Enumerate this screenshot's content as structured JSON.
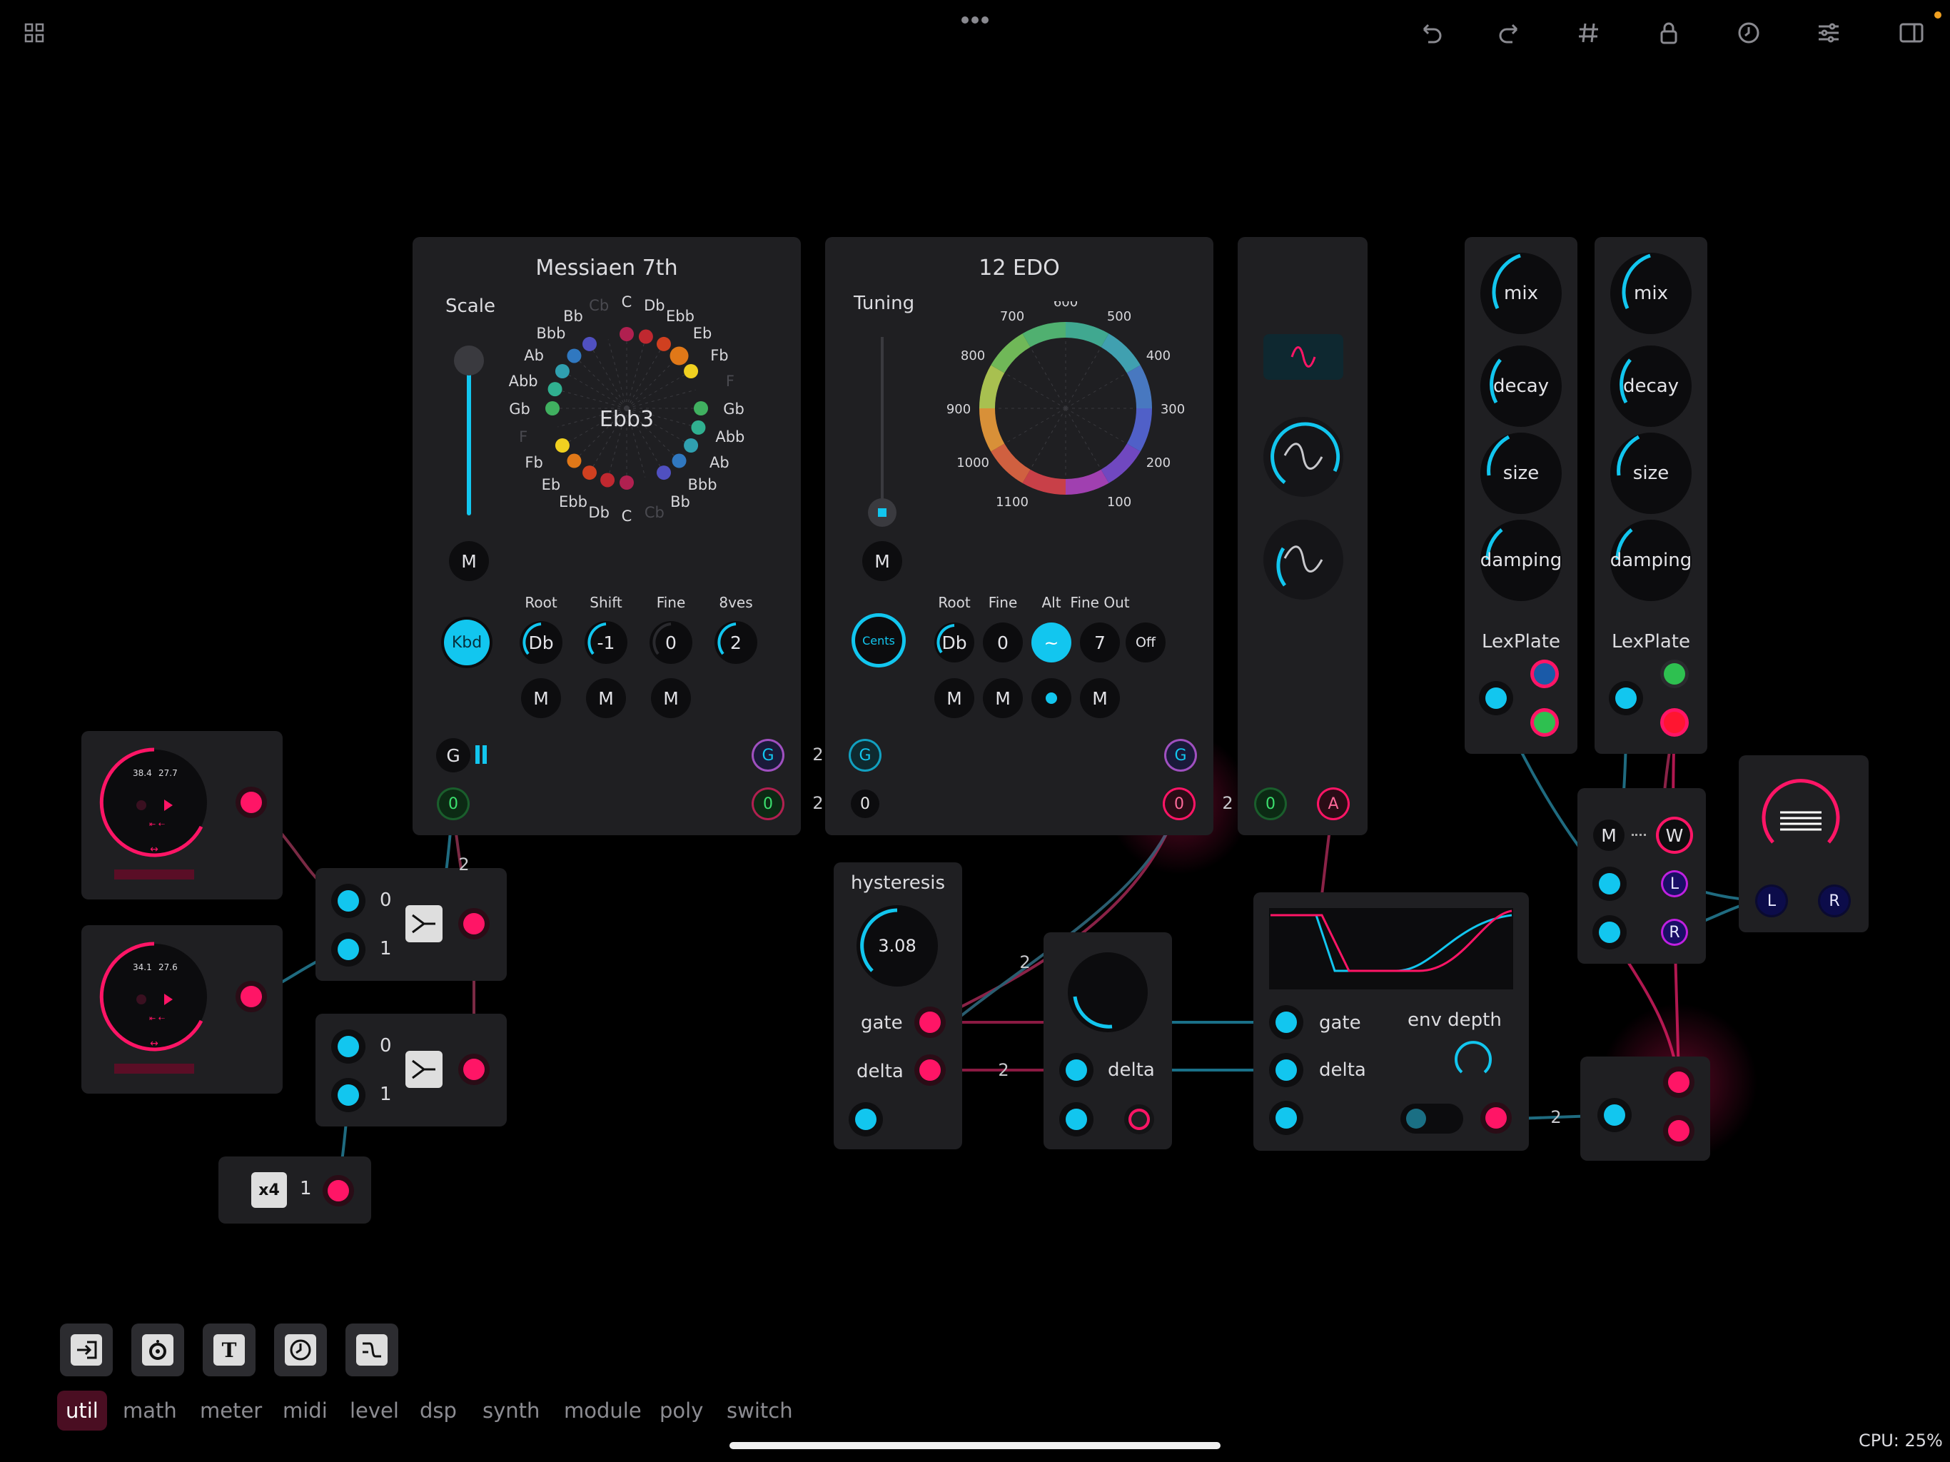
{
  "toolbar": {
    "icons": [
      "grid-icon",
      "more-icon",
      "undo-icon",
      "redo-icon",
      "hash-grid-icon",
      "lock-icon",
      "clock-icon",
      "sliders-icon",
      "sidebar-icon"
    ]
  },
  "scale_module": {
    "title": "Messiaen 7th",
    "scale_label": "Scale",
    "center_note": "Ebb3",
    "notes": [
      "C",
      "Db",
      "Ebb",
      "Eb",
      "Fb",
      "F",
      "Gb",
      "Abb",
      "Ab",
      "Bbb",
      "Bb",
      "Cb",
      "C",
      "Db",
      "Ebb",
      "Eb",
      "Fb",
      "F",
      "Gb",
      "Abb",
      "Ab",
      "Bbb",
      "Bb",
      "Cb"
    ],
    "kbd": "Kbd",
    "controls": [
      {
        "label": "Root",
        "value": "Db"
      },
      {
        "label": "Shift",
        "value": "-1"
      },
      {
        "label": "Fine",
        "value": "0"
      },
      {
        "label": "8ves",
        "value": "2"
      }
    ],
    "m": "M",
    "g": "G",
    "zero": "0"
  },
  "tuning_module": {
    "title": "12 EDO",
    "tuning_label": "Tuning",
    "cents_labels": [
      "500",
      "600",
      "700",
      "400",
      "800",
      "300",
      "900",
      "200",
      "1000",
      "100",
      "1100"
    ],
    "cents_btn": "Cents",
    "controls": [
      {
        "label": "Root",
        "value": "Db"
      },
      {
        "label": "Fine",
        "value": "0"
      },
      {
        "label": "Alt",
        "value": "~"
      },
      {
        "label": "Fine Out",
        "value": "7"
      },
      {
        "label": "",
        "value": "Off"
      }
    ],
    "m": "M",
    "g": "G",
    "zero": "0",
    "a": "A"
  },
  "reverb1": {
    "knobs": [
      "mix",
      "decay",
      "size",
      "damping"
    ],
    "name": "LexPlate"
  },
  "reverb2": {
    "knobs": [
      "mix",
      "decay",
      "size",
      "damping"
    ],
    "name": "LexPlate"
  },
  "players": [
    {
      "val1": "38.4",
      "val2": "27.7"
    },
    {
      "val1": "34.1",
      "val2": "27.6"
    }
  ],
  "merge1": {
    "in0": "0",
    "in1": "1"
  },
  "merge2": {
    "in0": "0",
    "in1": "1"
  },
  "multiplier": {
    "icon": "x4",
    "value": "1"
  },
  "hysteresis": {
    "title": "hysteresis",
    "value": "3.08",
    "gate": "gate",
    "delta": "delta"
  },
  "delta_module": {
    "delta": "delta"
  },
  "envelope": {
    "gate": "gate",
    "delta": "delta",
    "env_depth": "env depth"
  },
  "mixer": {
    "m": "M",
    "w": "W",
    "l": "L",
    "r": "R"
  },
  "output": {
    "l": "L",
    "r": "R"
  },
  "wire_labels": {
    "two": "2"
  },
  "tools": [
    "input-icon",
    "speaker-icon",
    "text-icon",
    "clock-icon",
    "filter-icon"
  ],
  "tabs": [
    "util",
    "math",
    "meter",
    "midi",
    "level",
    "dsp",
    "synth",
    "module",
    "poly",
    "switch"
  ],
  "active_tab": "util",
  "cpu": "CPU: 25%",
  "colors": {
    "accent": "#12c6ef",
    "pink": "#ff1566",
    "panel": "#1f1f22"
  }
}
